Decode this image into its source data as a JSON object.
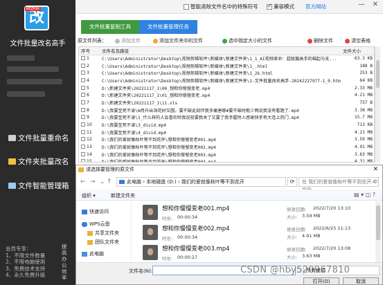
{
  "sidebar": {
    "logo_tag": "KEZHIA",
    "logo_char": "改",
    "title": "文件批量改名高手",
    "nav": [
      {
        "label": "文件批量重命名"
      },
      {
        "label": "文件夹批量改名"
      },
      {
        "label": "文件智能管理箱"
      }
    ],
    "member_note": [
      "会员专享：",
      "1、不限文件数量",
      "2、不限电脑使用",
      "3、免费技术支持",
      "4、永久免费升级"
    ],
    "vertical_tag": "提高办公效率"
  },
  "topbar": {
    "special_chars_label": "智能清除文件名中的特殊符号",
    "compat_label": "兼容模式",
    "official_link": "官方网站",
    "min": "—",
    "close": "✕"
  },
  "tabs": [
    {
      "label": "文件批量复制工具"
    },
    {
      "label": "文件批量管理任务"
    }
  ],
  "toolbar": {
    "list_label": "原文件列表：",
    "add_file": "添加文件",
    "add_folder_files": "添加文件夹中的文件",
    "select_size": "选中指定大小的文件",
    "delete_file": "删除文件",
    "clear_table": "清空表格"
  },
  "table": {
    "headers": [
      "序号",
      "文件名及路径",
      "文件大小"
    ],
    "rows": [
      {
        "n": "1",
        "path": "C:\\Users\\Administrator\\Desktop\\视频剪辑软件\\新媒体\\新建文件夹\\1_1_AI视频革命：超级篇高手的崛起与无...",
        "size": "63.3 KB"
      },
      {
        "n": "2",
        "path": "C:\\Users\\Administrator\\Desktop\\视频剪辑软件\\新媒体\\新建文件夹\\1_.html",
        "size": "188 B"
      },
      {
        "n": "3",
        "path": "C:\\Users\\Administrator\\Desktop\\视频剪辑软件\\新媒体\\新建文件夹\\1_2k.html",
        "size": "253 B"
      },
      {
        "n": "4",
        "path": "C:\\Users\\Administrator\\Desktop\\视频剪辑软件\\新媒体\\新建文件夹\\1-文件批量改名高手-20242227977-1_0.html",
        "size": "64 KB"
      },
      {
        "n": "5",
        "path": "D:\\新建文件夹\\20221117_1\\00_想和你慢慢变老.mp4",
        "size": "2.33 MB"
      },
      {
        "n": "6",
        "path": "D:\\新建文件夹\\20221117_1\\01_想和你慢慢变老.mp4",
        "size": "4.21 MB"
      },
      {
        "n": "7",
        "path": "D:\\新建文件夹\\20221117_1\\11.xls",
        "size": "757 B"
      },
      {
        "n": "8",
        "path": "D:\\我要至死不渝\\W月升出海花好又圆，要不破此刻伴我多痛害哪#要不破时能少两说我没有看题了.mp4",
        "size": "3.38 MB"
      },
      {
        "n": "9",
        "path": "D:\\我要至死不渝\\1_什么样的人会喜欢听我说前要我关了又要了我手握所人感谢快手有大连上热门.mp4",
        "size": "15.7 MB"
      },
      {
        "n": "10",
        "path": "D:\\我要至死不渝\\3_divid.mp4",
        "size": "713 KB"
      },
      {
        "n": "11",
        "path": "D:\\我要至死不渝\\4_divid.mp4",
        "size": "4.21 MB"
      },
      {
        "n": "12",
        "path": "D:\\我们的爱就像秋叶等不到花开\\想和你慢慢变老001.mp4",
        "size": "3.59 MB"
      },
      {
        "n": "13",
        "path": "D:\\我们的爱就像秋叶等不到花开\\想和你慢慢变老002.mp4",
        "size": "4.91 MB"
      },
      {
        "n": "14",
        "path": "D:\\我们的爱就像秋叶等不到花开\\想和你慢慢变老003.mp4",
        "size": "3.63 MB"
      },
      {
        "n": "15",
        "path": "D:\\我们的爱就像秋叶等不到花开\\想和你慢慢变老004.mp4",
        "size": "4.31 MB"
      }
    ]
  },
  "dialog": {
    "title": "请选择要管理的原文件",
    "close": "✕",
    "breadcrumb": "此电脑 › 本地磁盘 (D:) › 我们的爱就像秋叶等不到花开",
    "search_placeholder": "在 我们的爱就像秋叶等不到花开 中搜索",
    "organize": "组织 ▾",
    "new_folder": "新建文件夹",
    "tree": [
      {
        "label": "快速访问"
      },
      {
        "label": "WPS云盘"
      },
      {
        "label": "共享文件夹"
      },
      {
        "label": "团队文件夹"
      },
      {
        "label": "此电脑"
      }
    ],
    "files": [
      {
        "name": "想和你慢慢变老001.mp4",
        "modified_label": "修改日期:",
        "modified": "2022/7/20 13:10",
        "duration_label": "时长:",
        "duration": "00:00:34",
        "size_label": "大小:",
        "size": "3.59 MB"
      },
      {
        "name": "想和你慢慢变老002.mp4",
        "modified_label": "修改日期:",
        "modified": "2022/6/25 11:13",
        "duration_label": "时长:",
        "duration": "00:00:34",
        "size_label": "大小:",
        "size": "4.91 MB"
      },
      {
        "name": "想和你慢慢变老003.mp4",
        "modified_label": "修改日期:",
        "modified": "2022/7/20 13:08",
        "duration_label": "时长:",
        "duration": "00:00:27",
        "size_label": "大小:",
        "size": "3.63 MB"
      }
    ],
    "filename_label": "文件名(N):",
    "filetype": "所有格式",
    "open": "打开(O)",
    "cancel": "取消"
  },
  "watermark": "CSDN @hby520967810",
  "colors": {
    "sidebar": "#2b2b2b",
    "tab_green": "#3f9a3f",
    "tab_blue": "#2f82e0",
    "link": "#1a73e8"
  }
}
